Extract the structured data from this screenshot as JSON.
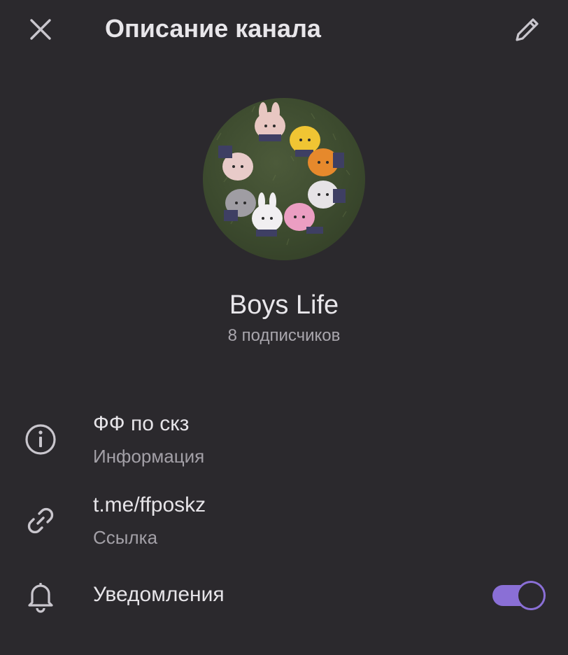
{
  "header": {
    "title": "Описание канала",
    "close_icon": "close-icon",
    "edit_icon": "pencil-icon"
  },
  "channel": {
    "name": "Boys Life",
    "subscribers": "8 подписчиков",
    "avatar": "photo of a circle of plush toys on grass"
  },
  "info_rows": [
    {
      "icon": "info-icon",
      "primary": "ФФ по скз",
      "secondary": "Информация"
    },
    {
      "icon": "link-icon",
      "primary": "t.me/ffposkz",
      "secondary": "Ссылка"
    }
  ],
  "notifications": {
    "icon": "bell-icon",
    "label": "Уведомления",
    "enabled": true
  },
  "colors": {
    "background": "#2b292d",
    "accent": "#8a6fd6",
    "text_primary": "#e6e4e8",
    "text_secondary": "#a3a0a7"
  }
}
